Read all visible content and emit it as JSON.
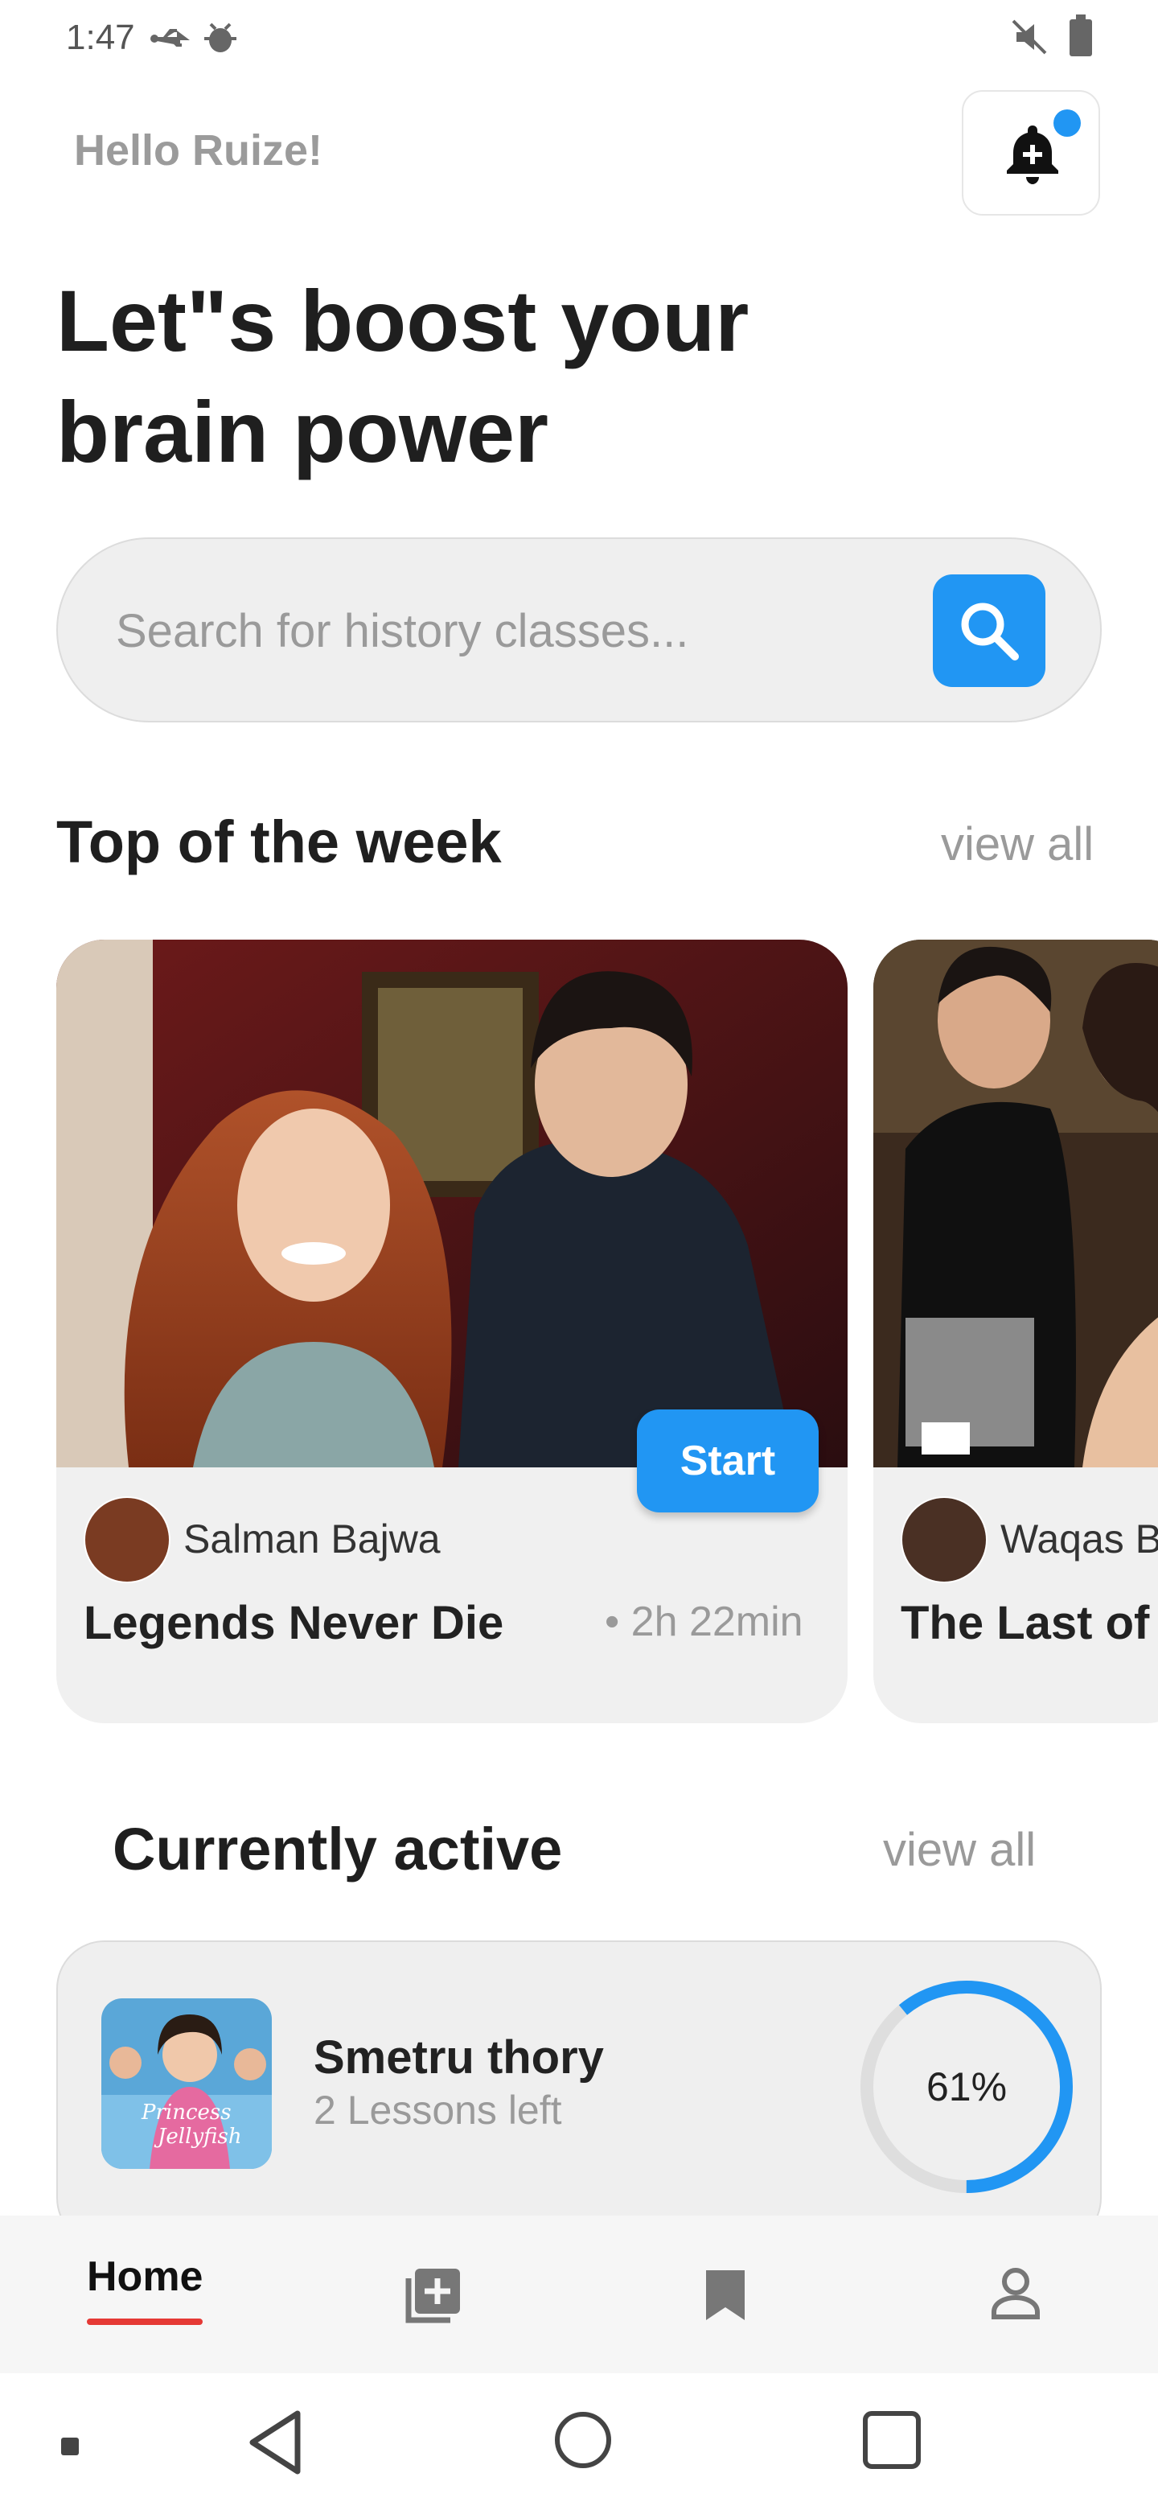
{
  "status_bar": {
    "time": "1:47"
  },
  "header": {
    "greeting": "Hello Ruize!",
    "headline_line1": "Let\"s boost your",
    "headline_line2": "brain power"
  },
  "search": {
    "placeholder": "Search for history classes..."
  },
  "top_week": {
    "title": "Top of the week",
    "view_all": "view all",
    "cards": [
      {
        "author": "Salman Bajwa",
        "title": "Legends Never Die",
        "duration": "• 2h 22min",
        "start_label": "Start"
      },
      {
        "author": "Waqas B",
        "title": "The Last of"
      }
    ]
  },
  "active": {
    "title": "Currently active",
    "view_all": "view all",
    "course": {
      "title": "Smetru thory",
      "subtitle": "2 Lessons left",
      "progress_label": "61%",
      "progress": 0.61,
      "thumb_text_1": "Princess",
      "thumb_text_2": "Jellyfish"
    }
  },
  "nav": {
    "home": "Home"
  },
  "colors": {
    "accent": "#2196f3",
    "nav_underline": "#e53935"
  }
}
